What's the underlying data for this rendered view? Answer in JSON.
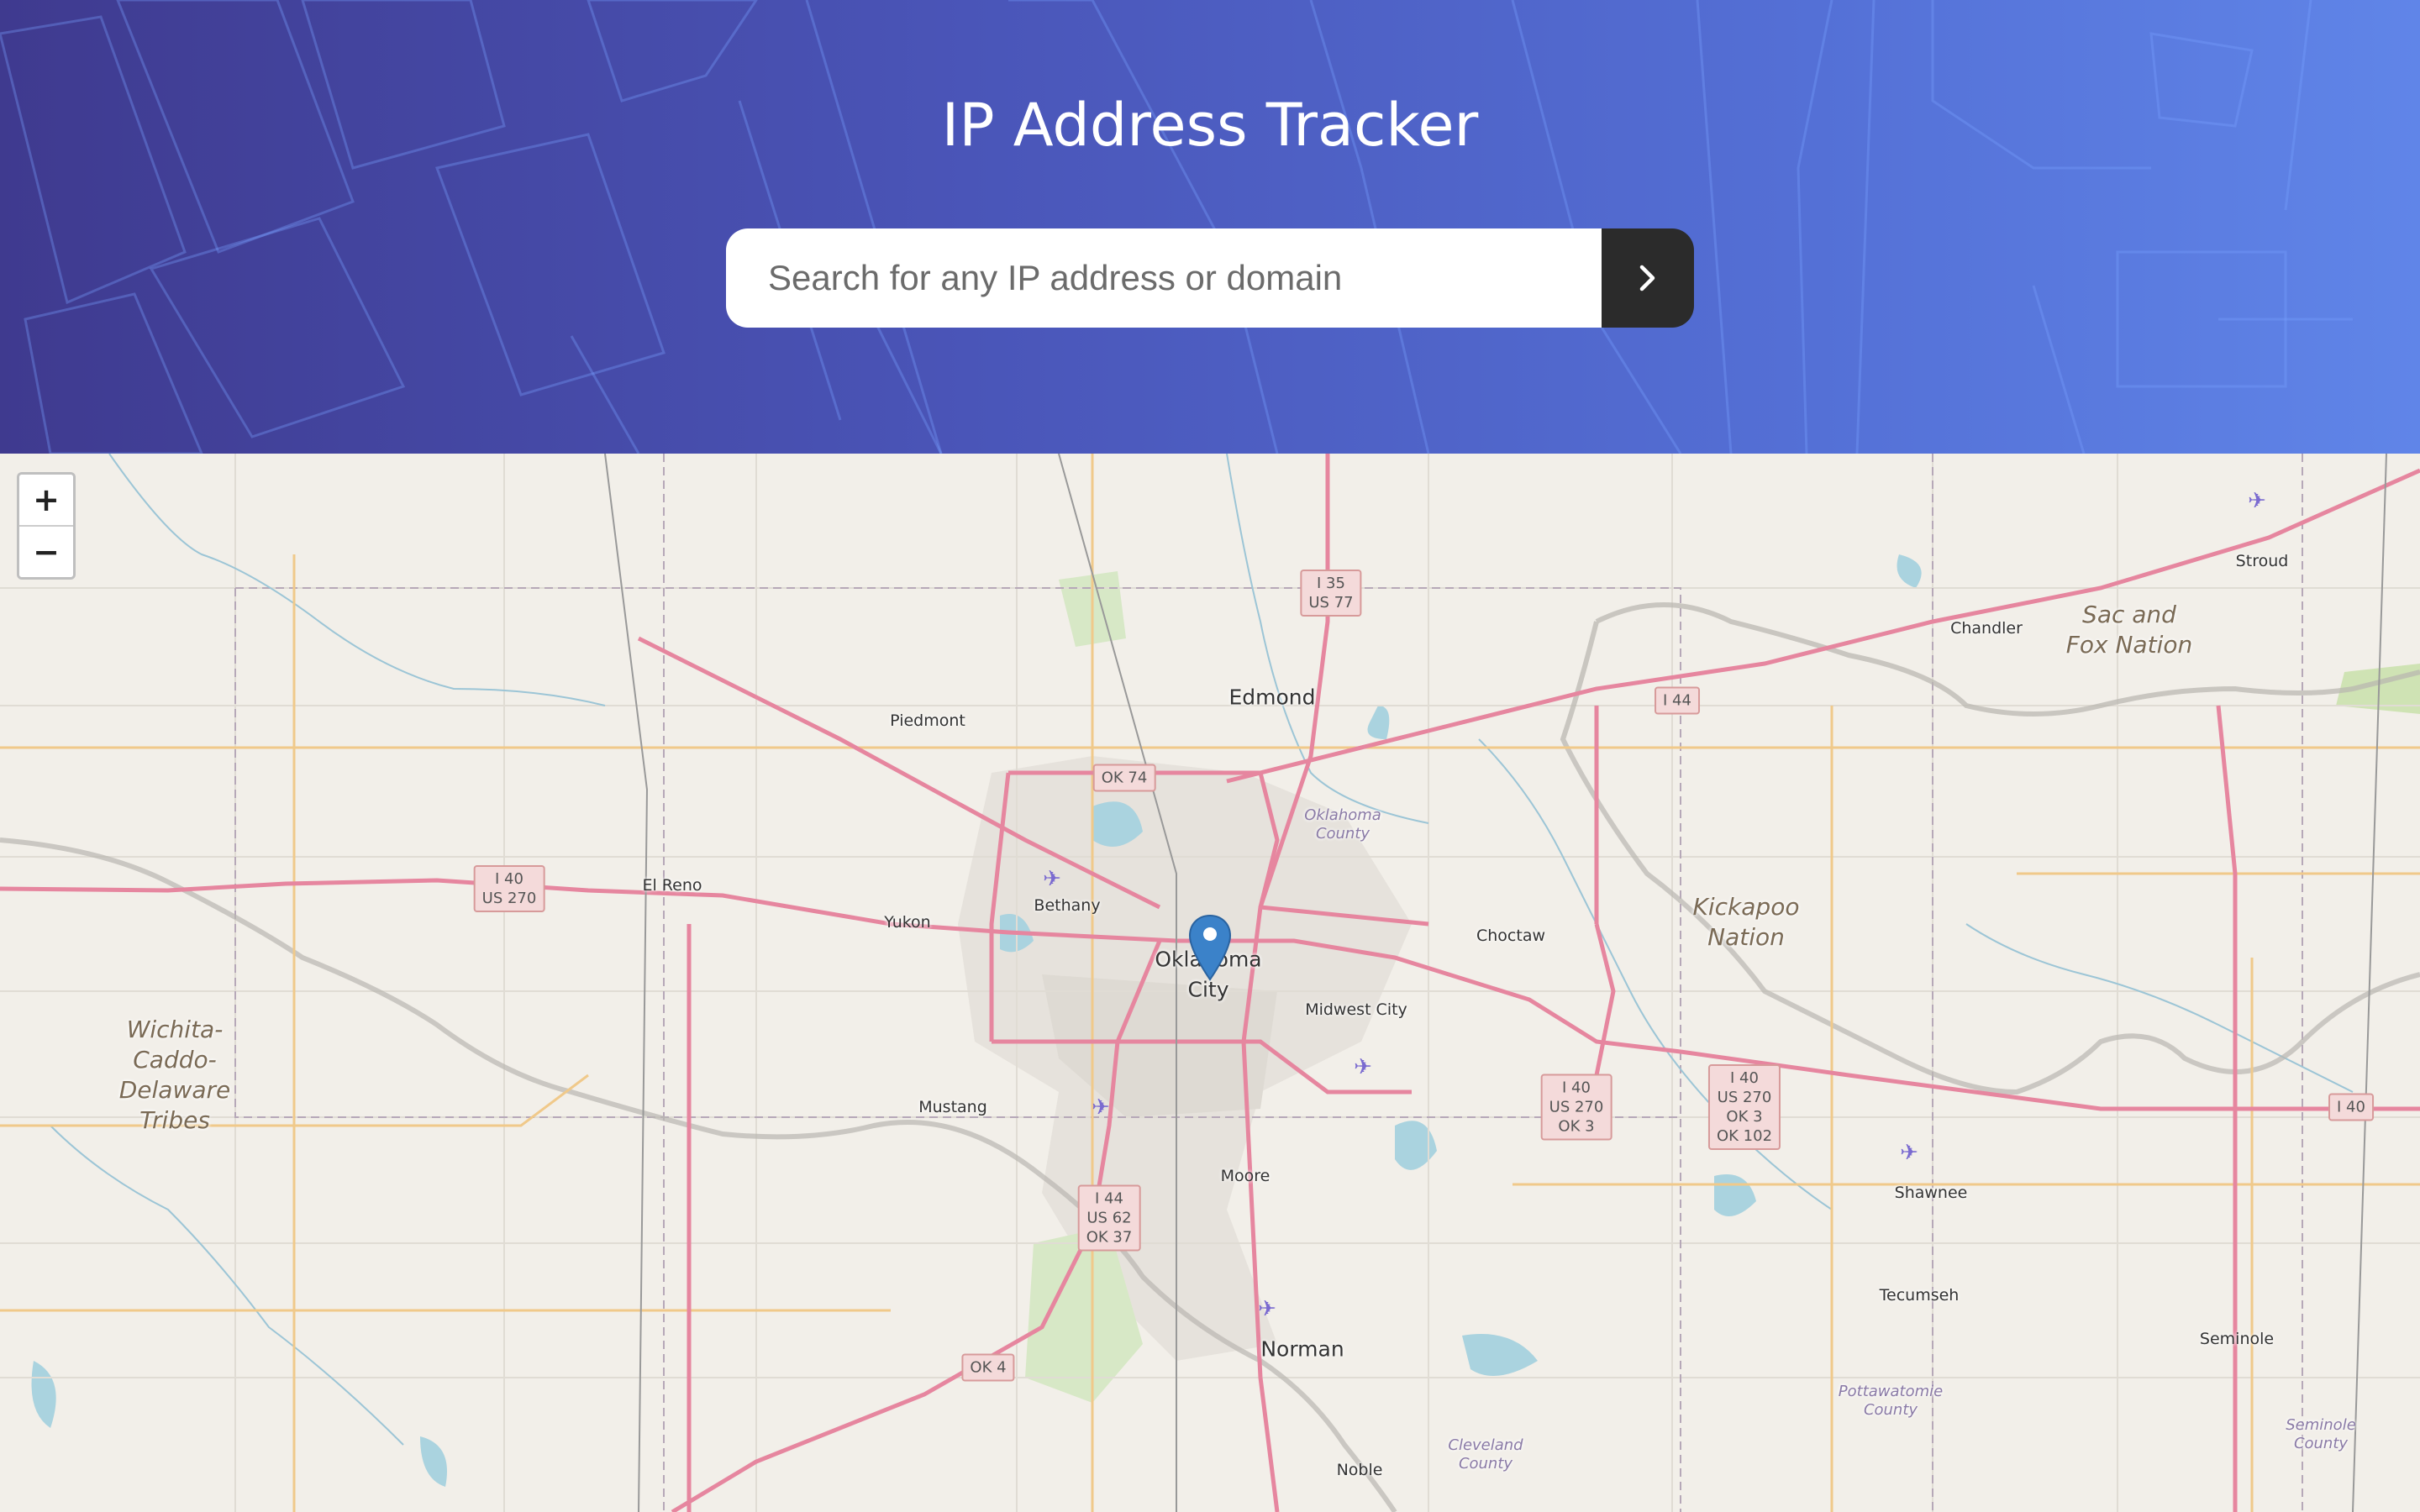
{
  "header": {
    "title": "IP Address Tracker",
    "search_placeholder": "Search for any IP address or domain",
    "search_value": "",
    "submit_icon": "chevron-right-icon"
  },
  "map": {
    "zoom_in_label": "+",
    "zoom_out_label": "−",
    "marker_icon": "map-pin-icon",
    "labels": {
      "edmond": "Edmond",
      "piedmont": "Piedmont",
      "el_reno": "El Reno",
      "yukon": "Yukon",
      "bethany": "Bethany",
      "oklahoma_city_1": "Oklahoma",
      "oklahoma_city_2": "City",
      "choctaw": "Choctaw",
      "midwest_city": "Midwest City",
      "mustang": "Mustang",
      "moore": "Moore",
      "norman": "Norman",
      "noble": "Noble",
      "shawnee": "Shawnee",
      "tecumseh": "Tecumseh",
      "seminole": "Seminole",
      "stroud": "Stroud",
      "chandler": "Chandler",
      "sac_fox_1": "Sac and",
      "sac_fox_2": "Fox Nation",
      "kickapoo_1": "Kickapoo",
      "kickapoo_2": "Nation",
      "wichita_1": "Wichita-",
      "wichita_2": "Caddo-",
      "wichita_3": "Delaware",
      "wichita_4": "Tribes",
      "ok_county_1": "Oklahoma",
      "ok_county_2": "County",
      "pott_county_1": "Pottawatomie",
      "pott_county_2": "County",
      "cleveland_county_1": "Cleveland",
      "cleveland_county_2": "County",
      "seminole_county_1": "Seminole",
      "seminole_county_2": "County"
    },
    "shields": {
      "i35_1": "I 35",
      "i35_2": "US 77",
      "i44_ne": "I 44",
      "ok74": "OK 74",
      "i40w_1": "I 40",
      "i40w_2": "US 270",
      "i40c_1": "I 40",
      "i40c_2": "US 270",
      "i40c_3": "OK 3",
      "i40e_1": "I 40",
      "i40e_2": "US 270",
      "i40e_3": "OK 3",
      "i40e_4": "OK 102",
      "i40_far": "I 40",
      "i44s_1": "I 44",
      "i44s_2": "US 62",
      "i44s_3": "OK 37",
      "ok4": "OK 4"
    }
  }
}
